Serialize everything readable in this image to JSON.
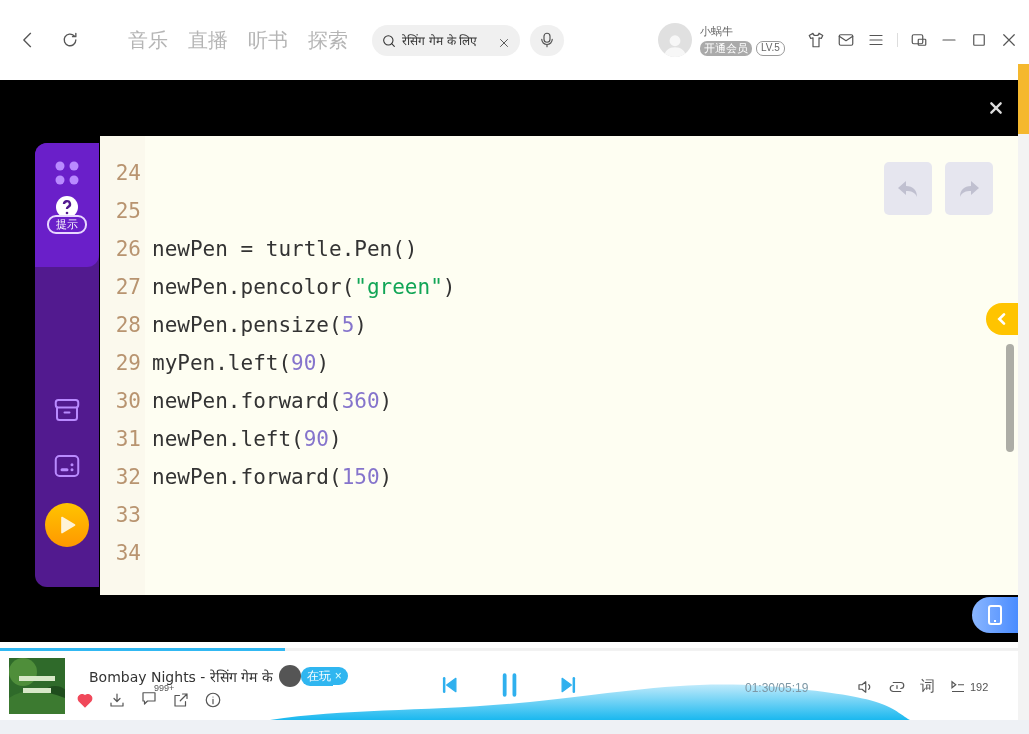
{
  "nav_tabs": [
    {
      "label": "音乐",
      "selected": false
    },
    {
      "label": "直播",
      "selected": false
    },
    {
      "label": "听书",
      "selected": false
    },
    {
      "label": "探索",
      "selected": false
    }
  ],
  "search": {
    "value": "रेसिंग गेम के लिए"
  },
  "user": {
    "name": "小蜗牛",
    "vip_badge": "开通会员",
    "level": "LV.5"
  },
  "sidebar": {
    "hint_label": "提示"
  },
  "editor": {
    "lines": [
      {
        "number": "24"
      },
      {
        "number": "25"
      },
      {
        "number": "26",
        "tokens": [
          {
            "text": "newPen = turtle.Pen()",
            "kind": "plain"
          }
        ]
      },
      {
        "number": "27",
        "tokens": [
          {
            "text": "newPen.pencolor(",
            "kind": "plain"
          },
          {
            "text": "\"green\"",
            "kind": "string"
          },
          {
            "text": ")",
            "kind": "plain"
          }
        ]
      },
      {
        "number": "28",
        "tokens": [
          {
            "text": "newPen.pensize(",
            "kind": "plain"
          },
          {
            "text": "5",
            "kind": "number"
          },
          {
            "text": ")",
            "kind": "plain"
          }
        ]
      },
      {
        "number": "29",
        "tokens": [
          {
            "text": "myPen.left(",
            "kind": "plain"
          },
          {
            "text": "90",
            "kind": "number"
          },
          {
            "text": ")",
            "kind": "plain"
          }
        ]
      },
      {
        "number": "30",
        "tokens": [
          {
            "text": "newPen.forward(",
            "kind": "plain"
          },
          {
            "text": "360",
            "kind": "number"
          },
          {
            "text": ")",
            "kind": "plain"
          }
        ]
      },
      {
        "number": "31",
        "tokens": [
          {
            "text": "newPen.left(",
            "kind": "plain"
          },
          {
            "text": "90",
            "kind": "number"
          },
          {
            "text": ")",
            "kind": "plain"
          }
        ]
      },
      {
        "number": "32",
        "tokens": [
          {
            "text": "newPen.forward(",
            "kind": "plain"
          },
          {
            "text": "150",
            "kind": "number"
          },
          {
            "text": ")",
            "kind": "plain"
          }
        ]
      },
      {
        "number": "33"
      },
      {
        "number": "34"
      }
    ]
  },
  "player": {
    "title": "Bombay Nights - रेसिंग गेम के",
    "status_badge": "在玩",
    "status_badge_close": "×",
    "liked": true,
    "comment_count": "999+",
    "time": "01:30/05:19",
    "lyrics_label": "词",
    "playlist_count": "192",
    "progress": {
      "level": 0.28
    }
  }
}
